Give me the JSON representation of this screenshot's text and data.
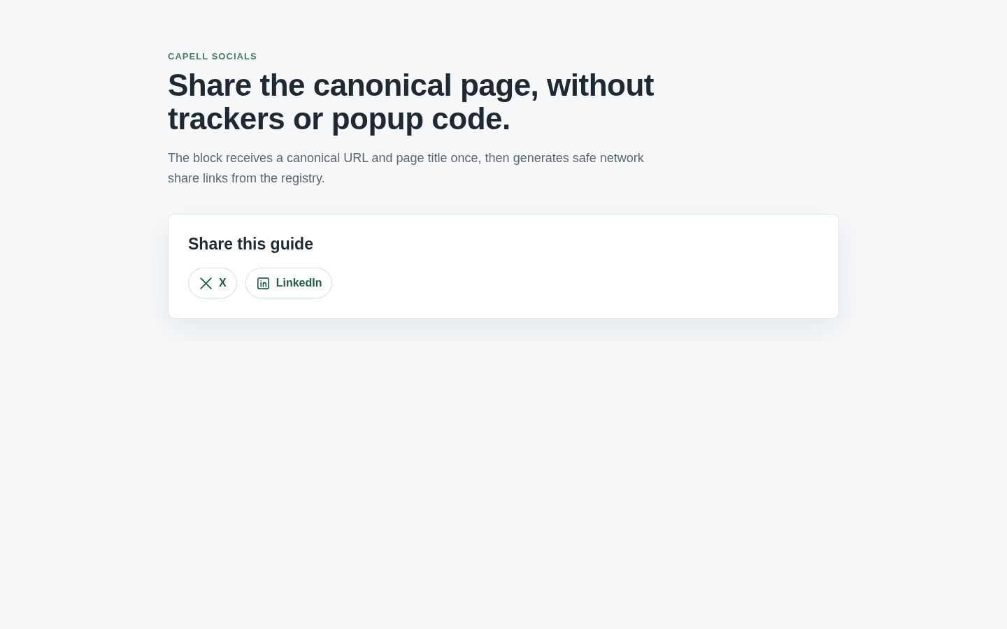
{
  "eyebrow": "CAPELL SOCIALS",
  "headline": "Share the canonical page, without trackers or popup code.",
  "intro": "The block receives a canonical URL and page title once, then generates safe network share links from the registry.",
  "share_card": {
    "title": "Share this guide",
    "links": [
      {
        "kind": "x",
        "label": "X"
      },
      {
        "kind": "linkedin",
        "label": "LinkedIn"
      }
    ]
  }
}
